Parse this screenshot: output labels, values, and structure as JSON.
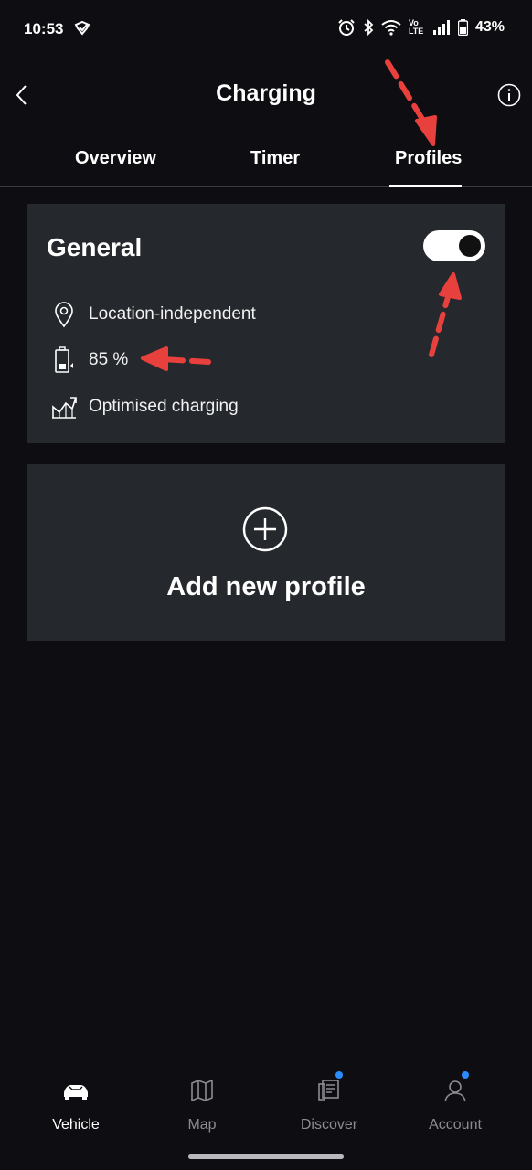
{
  "status_bar": {
    "time": "10:53",
    "battery": "43%",
    "volte": "Vo\nLTE",
    "icons": [
      "check-shield-icon",
      "alarm-icon",
      "bluetooth-icon",
      "wifi-icon",
      "volte-icon",
      "signal-icon",
      "battery-icon"
    ]
  },
  "header": {
    "title": "Charging",
    "back_icon": "chevron-left-icon",
    "info_icon": "info-icon"
  },
  "tabs": [
    {
      "label": "Overview",
      "active": false
    },
    {
      "label": "Timer",
      "active": false
    },
    {
      "label": "Profiles",
      "active": true
    }
  ],
  "profile": {
    "name": "General",
    "enabled": true,
    "location": "Location-independent",
    "target_charge": "85 %",
    "mode": "Optimised charging"
  },
  "add_profile": {
    "label": "Add new profile"
  },
  "bottom_nav": [
    {
      "label": "Vehicle",
      "icon": "car-icon",
      "active": true
    },
    {
      "label": "Map",
      "icon": "map-icon",
      "active": false
    },
    {
      "label": "Discover",
      "icon": "discover-icon",
      "active": false,
      "badge": true
    },
    {
      "label": "Account",
      "icon": "account-icon",
      "active": false,
      "badge": true
    }
  ],
  "colors": {
    "background": "#0e0e12",
    "card": "#25282d",
    "annotation_arrow": "#e8403d",
    "badge": "#2a8cff"
  }
}
